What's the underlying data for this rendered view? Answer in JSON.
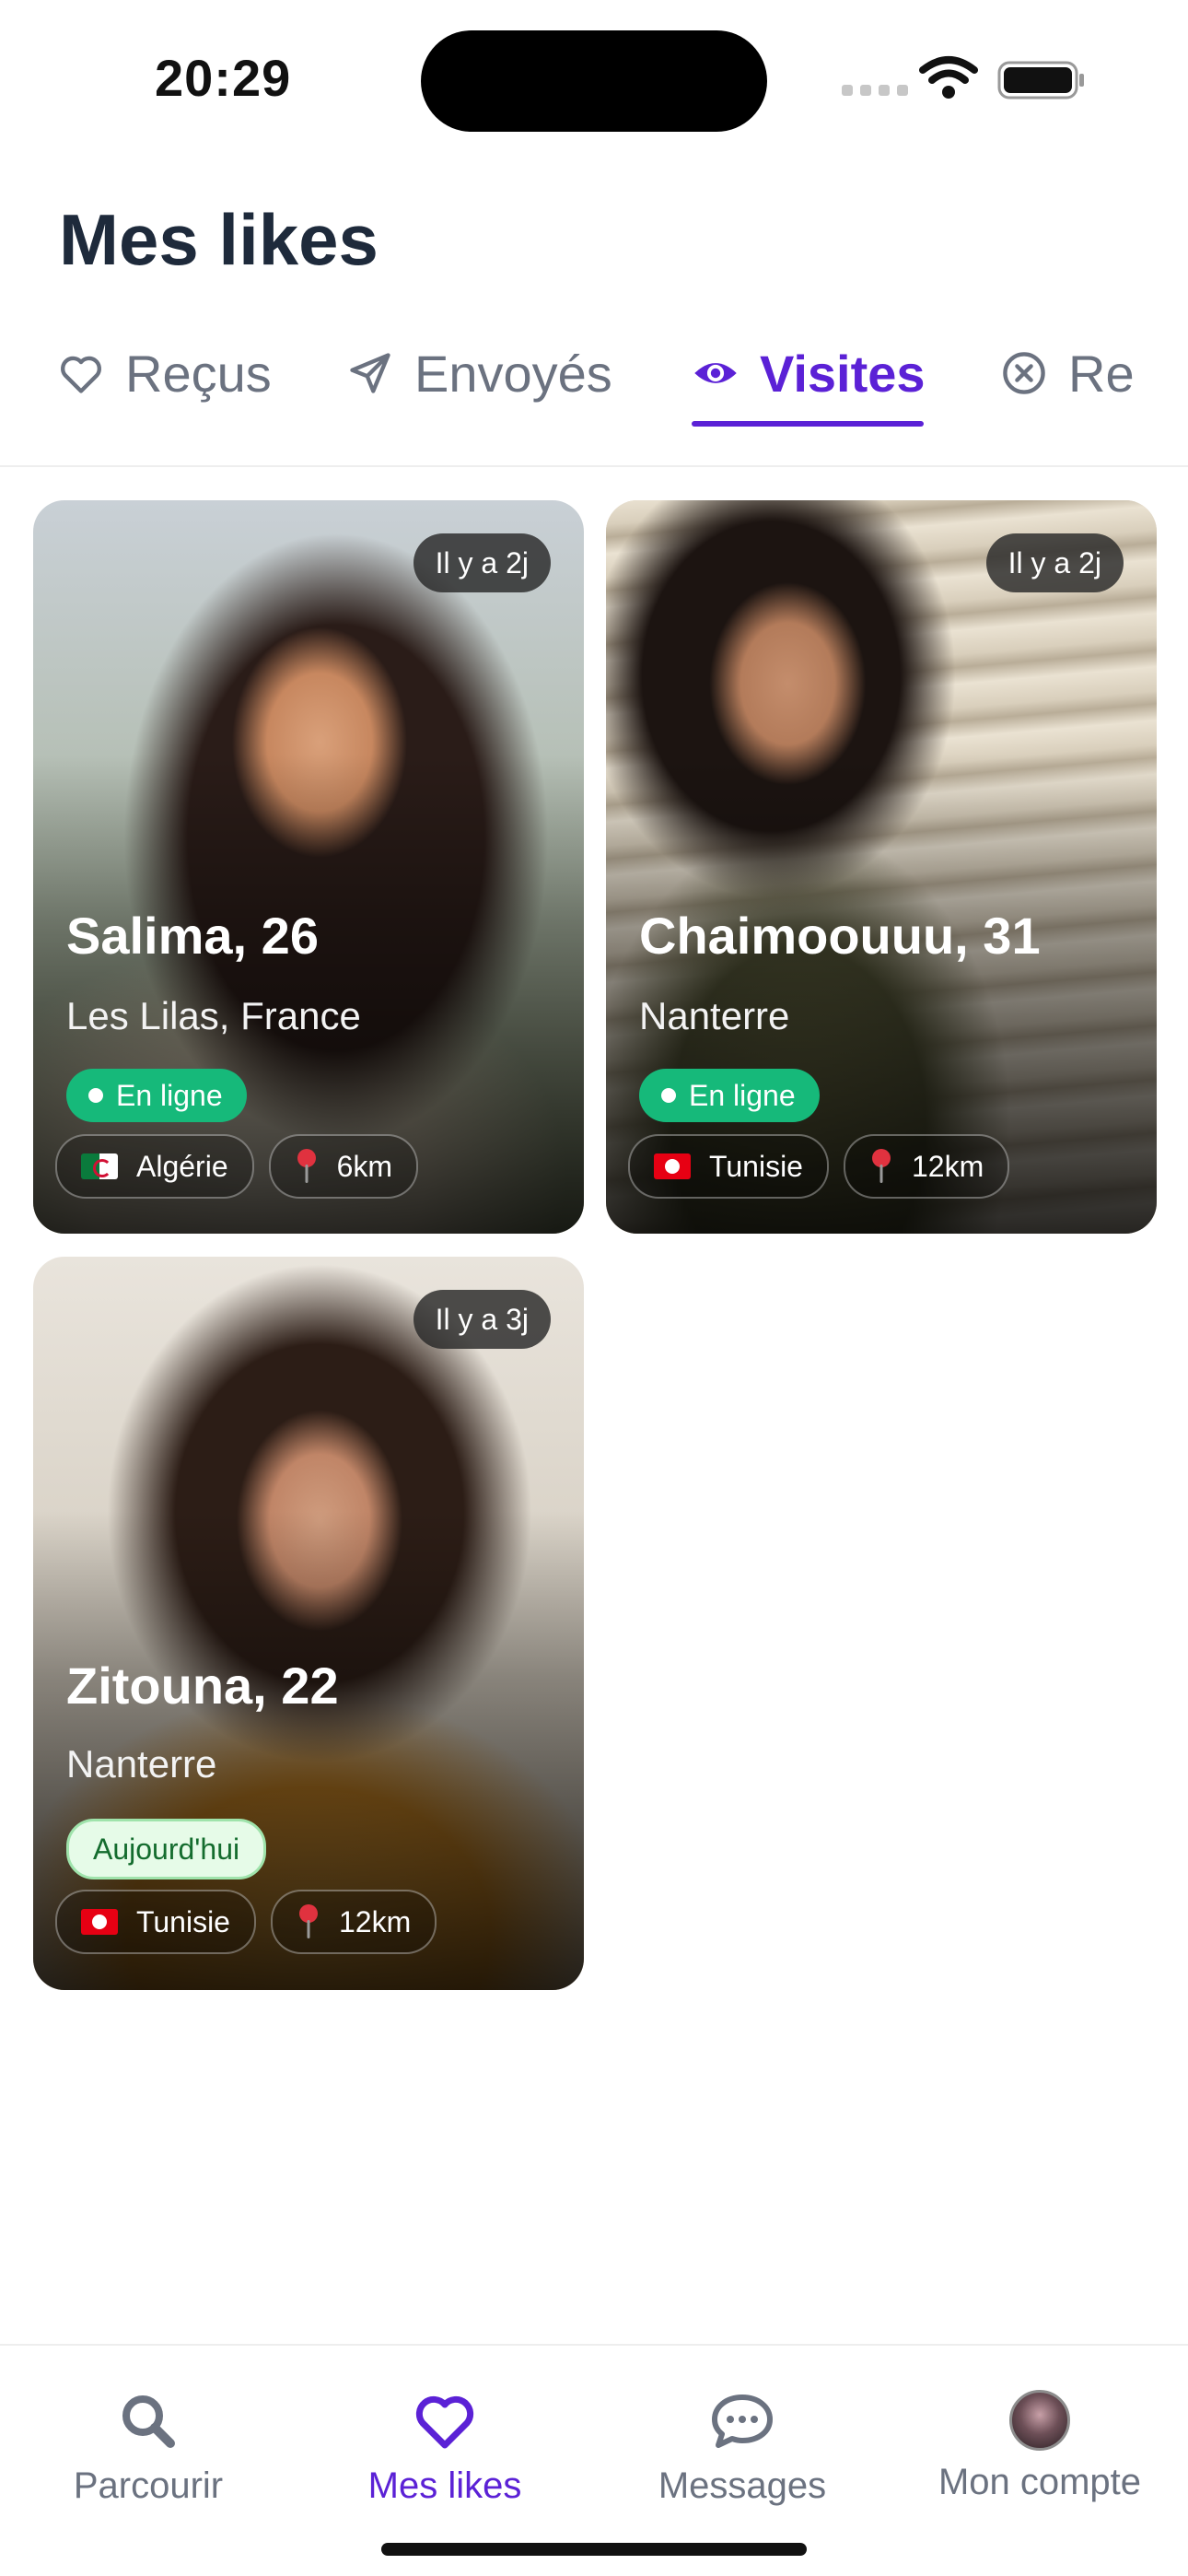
{
  "status_bar": {
    "time": "20:29"
  },
  "page": {
    "title": "Mes likes"
  },
  "tabs": [
    {
      "label": "Reçus",
      "icon": "heart-outline-icon",
      "active": false
    },
    {
      "label": "Envoyés",
      "icon": "paper-plane-icon",
      "active": false
    },
    {
      "label": "Visites",
      "icon": "eye-icon",
      "active": true
    },
    {
      "label": "Re",
      "icon": "x-circle-icon",
      "active": false
    }
  ],
  "cards": [
    {
      "name_age": "Salima, 26",
      "city": "Les Lilas, France",
      "time_ago": "Il y a 2j",
      "status": "En ligne",
      "country": "Algérie",
      "distance": "6km"
    },
    {
      "name_age": "Chaimoouuu, 31",
      "city": "Nanterre",
      "time_ago": "Il y a 2j",
      "status": "En ligne",
      "country": "Tunisie",
      "distance": "12km"
    },
    {
      "name_age": "Zitouna, 22",
      "city": "Nanterre",
      "time_ago": "Il y a 3j",
      "status": "Aujourd'hui",
      "country": "Tunisie",
      "distance": "12km"
    }
  ],
  "nav": [
    {
      "label": "Parcourir",
      "icon": "search-icon",
      "active": false
    },
    {
      "label": "Mes likes",
      "icon": "heart-icon",
      "active": true
    },
    {
      "label": "Messages",
      "icon": "chat-bubble-icon",
      "active": false
    },
    {
      "label": "Mon compte",
      "icon": "avatar",
      "active": false
    }
  ],
  "colors": {
    "accent": "#5b21d6",
    "online": "#16b97a",
    "today_bg": "#e6fbe8"
  }
}
